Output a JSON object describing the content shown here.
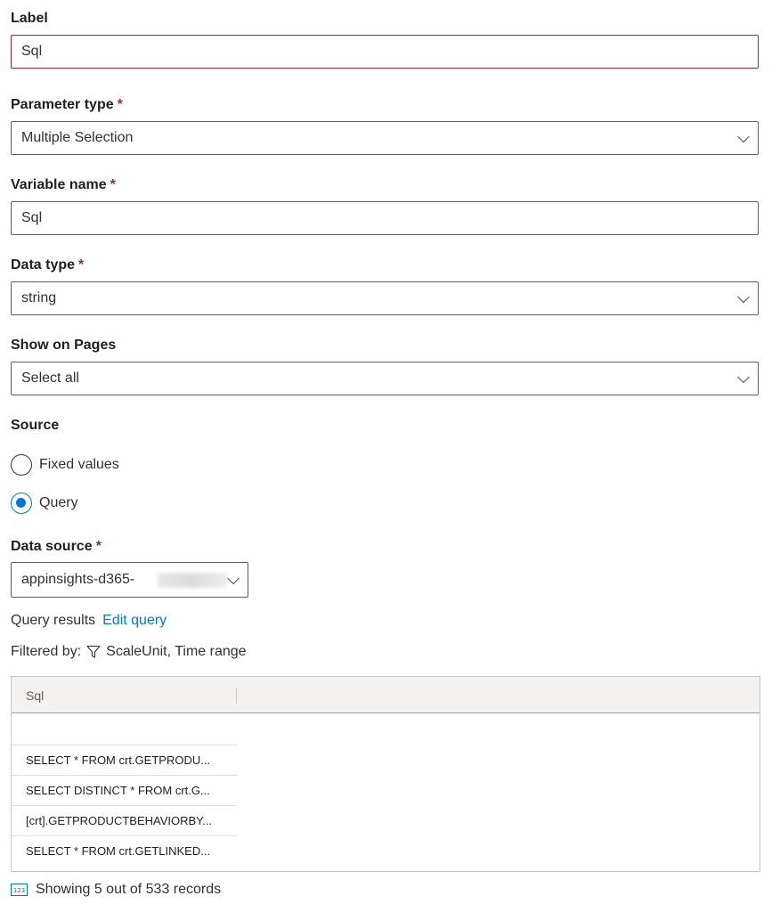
{
  "label_field": {
    "label": "Label",
    "value": "Sql"
  },
  "parameter_type": {
    "label": "Parameter type",
    "required_mark": "*",
    "value": "Multiple Selection"
  },
  "variable_name": {
    "label": "Variable name",
    "required_mark": "*",
    "value": "Sql"
  },
  "data_type": {
    "label": "Data type",
    "required_mark": "*",
    "value": "string"
  },
  "show_on_pages": {
    "label": "Show on Pages",
    "value": "Select all"
  },
  "source": {
    "label": "Source",
    "options": [
      {
        "label": "Fixed values",
        "checked": false
      },
      {
        "label": "Query",
        "checked": true
      }
    ]
  },
  "data_source": {
    "label": "Data source",
    "required_mark": "*",
    "value": "appinsights-d365-"
  },
  "query_results": {
    "label": "Query results",
    "edit_link": "Edit query"
  },
  "filtered_by": {
    "label": "Filtered by:",
    "value": "ScaleUnit, Time range"
  },
  "grid": {
    "column": "Sql",
    "rows": [
      "",
      "SELECT * FROM crt.GETPRODU...",
      "SELECT DISTINCT * FROM crt.G...",
      "[crt].GETPRODUCTBEHAVIORBY...",
      "SELECT * FROM crt.GETLINKED..."
    ]
  },
  "footer": {
    "icon_text": "123",
    "text": "Showing 5 out of 533 records"
  },
  "colors": {
    "accent": "#0078d4",
    "error": "#a4262c",
    "border": "#605e5c"
  }
}
